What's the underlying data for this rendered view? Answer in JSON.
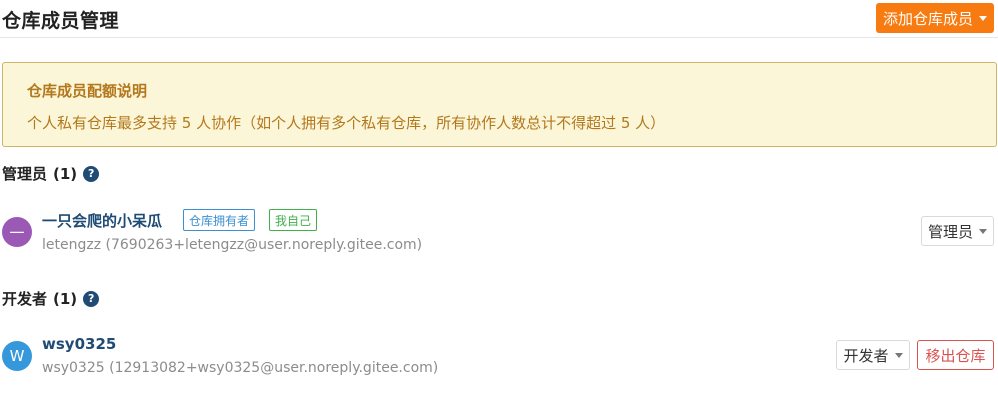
{
  "header": {
    "title": "仓库成员管理",
    "add_button_label": "添加仓库成员"
  },
  "notice": {
    "title": "仓库成员配额说明",
    "text": "个人私有仓库最多支持 5 人协作（如个人拥有多个私有仓库，所有协作人数总计不得超过 5 人）"
  },
  "sections": [
    {
      "title": "管理员",
      "count": "(1)",
      "members": [
        {
          "avatar_letter": "一",
          "avatar_color": "#9b59b6",
          "name": "一只会爬的小呆瓜",
          "tags": [
            "仓库拥有者",
            "我自己"
          ],
          "email": "letengzz (7690263+letengzz@user.noreply.gitee.com)",
          "role": "管理员"
        }
      ]
    },
    {
      "title": "开发者",
      "count": "(1)",
      "members": [
        {
          "avatar_letter": "W",
          "avatar_color": "#3498db",
          "name": "wsy0325",
          "email": "wsy0325 (12913082+wsy0325@user.noreply.gitee.com)",
          "role": "开发者",
          "remove_label": "移出仓库"
        }
      ]
    }
  ],
  "icons": {
    "help": "?"
  }
}
